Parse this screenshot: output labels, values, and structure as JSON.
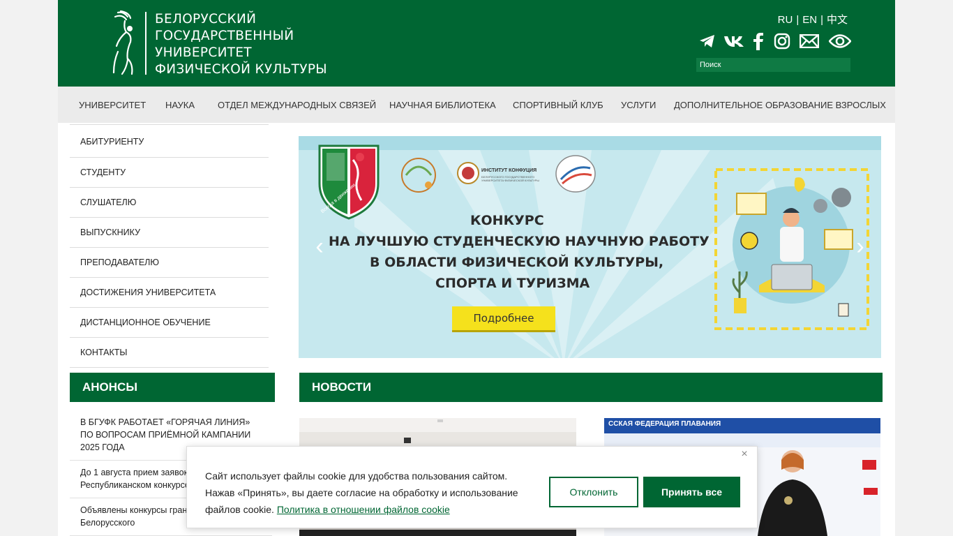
{
  "header": {
    "logo_lines": [
      "БЕЛОРУССКИЙ",
      "ГОСУДАРСТВЕННЫЙ",
      "УНИВЕРСИТЕТ",
      "ФИЗИЧЕСКОЙ КУЛЬТУРЫ"
    ],
    "languages": [
      "RU",
      "EN",
      "中文"
    ],
    "language_separator": "|",
    "search_placeholder": "Поиск",
    "socials": [
      "telegram-icon",
      "vk-icon",
      "facebook-icon",
      "instagram-icon",
      "mail-icon",
      "eye-icon"
    ]
  },
  "nav": {
    "items": [
      "УНИВЕРСИТЕТ",
      "НАУКА",
      "ОТДЕЛ МЕЖДУНАРОДНЫХ СВЯЗЕЙ",
      "НАУЧНАЯ БИБЛИОТЕКА",
      "СПОРТИВНЫЙ КЛУБ",
      "УСЛУГИ",
      "ДОПОЛНИТЕЛЬНОЕ ОБРАЗОВАНИЕ ВЗРОСЛЫХ"
    ]
  },
  "left_menu": {
    "items": [
      "АБИТУРИЕНТУ",
      "СТУДЕНТУ",
      "СЛУШАТЕЛЮ",
      "ВЫПУСКНИКУ",
      "ПРЕПОДАВАТЕЛЮ",
      "ДОСТИЖЕНИЯ УНИВЕРСИТЕТА",
      "ДИСТАНЦИОННОЕ ОБУЧЕНИЕ",
      "КОНТАКТЫ"
    ]
  },
  "slider": {
    "title_lines": [
      "КОНКУРС",
      "НА ЛУЧШУЮ СТУДЕНЧЕСКУЮ НАУЧНУЮ РАБОТУ",
      "В ОБЛАСТИ ФИЗИЧЕСКОЙ КУЛЬТУРЫ,",
      "СПОРТА И ТУРИЗМА"
    ],
    "button_label": "Подробнее",
    "prev_arrow": "‹",
    "next_arrow": "›",
    "crest_text": "Всегда в движении",
    "partner_caption": "ИНСТИТУТ КОНФУЦИЯ",
    "partner_subcaption": "БЕЛОРУССКОГО ГОСУДАРСТВЕННОГО УНИВЕРСИТЕТА ФИЗИЧЕСКОЙ КУЛЬТУРЫ"
  },
  "anons": {
    "heading": "АНОНСЫ",
    "items": [
      "В БГУФК РАБОТАЕТ «ГОРЯЧАЯ ЛИНИЯ» ПО ВОПРОСАМ ПРИЁМНОЙ КАМПАНИИ 2025 ГОДА",
      "До 1 августа прием заявок на Республиканском конкурсе проектов — 2025",
      "Объявлены конкурсы гранто исследования Белорусского"
    ]
  },
  "news": {
    "heading": "НОВОСТИ",
    "banner_text": "ССКАЯ ФЕДЕРАЦИЯ ПЛАВАНИЯ"
  },
  "cookie": {
    "text": "Сайт использует файлы cookie для удобства пользования сайтом. Нажав «Принять», вы даете согласие на обработку и использование файлов cookie.",
    "link": "Политика в отношении файлов cookie",
    "decline_label": "Отклонить",
    "accept_label": "Принять все",
    "close": "×"
  },
  "colors": {
    "brand_green": "#006633",
    "nav_bg": "#ebebeb",
    "slider_bg": "#bfe3ea",
    "button_yellow": "#f5e11c"
  }
}
